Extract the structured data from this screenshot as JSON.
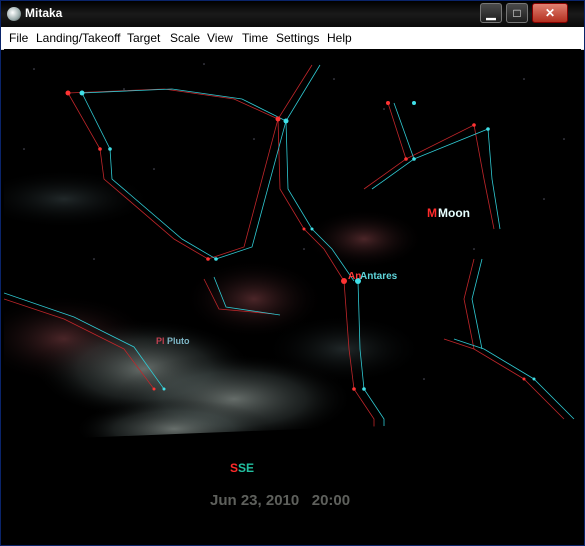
{
  "window": {
    "title": "Mitaka"
  },
  "window_buttons": {
    "minimize": "▁",
    "maximize": "□",
    "close": "✕"
  },
  "menu": [
    "File",
    "Landing/Takeoff",
    "Target",
    "Scale",
    "View",
    "Time",
    "Settings",
    "Help"
  ],
  "sky_labels": {
    "moon": "Moon",
    "moon_red": "M",
    "antares": "Antares",
    "antares_red": "An",
    "pluto": "Pluto",
    "pluto_red": "Pl"
  },
  "horizon": {
    "direction": "SE",
    "direction_red": "S"
  },
  "date": "Jun 23, 2010",
  "time": "20:00",
  "colors": {
    "anaglyph_red": "#ff2a2a",
    "anaglyph_cyan": "#30d0d8",
    "date_text": "#5e605c"
  }
}
